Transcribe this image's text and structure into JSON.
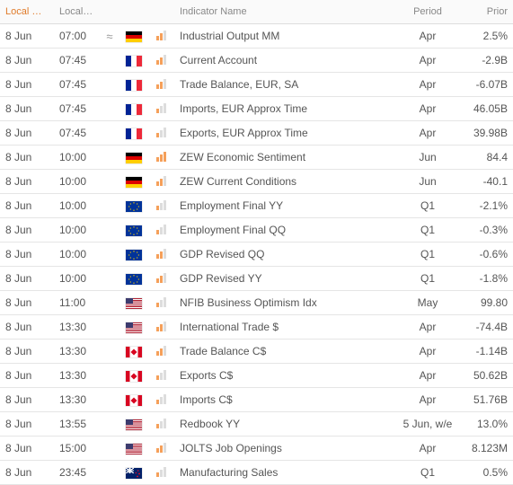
{
  "headers": {
    "date": "Local Date",
    "time": "Local Time",
    "name": "Indicator Name",
    "period": "Period",
    "prior": "Prior"
  },
  "rows": [
    {
      "date": "8 Jun",
      "time": "07:00",
      "approx": "≈",
      "flag": "de",
      "imp": 2,
      "name": "Industrial Output MM",
      "period": "Apr",
      "prior": "2.5%"
    },
    {
      "date": "8 Jun",
      "time": "07:45",
      "approx": "",
      "flag": "fr",
      "imp": 2,
      "name": "Current Account",
      "period": "Apr",
      "prior": "-2.9B"
    },
    {
      "date": "8 Jun",
      "time": "07:45",
      "approx": "",
      "flag": "fr",
      "imp": 2,
      "name": "Trade Balance, EUR, SA",
      "period": "Apr",
      "prior": "-6.07B"
    },
    {
      "date": "8 Jun",
      "time": "07:45",
      "approx": "",
      "flag": "fr",
      "imp": 1,
      "name": "Imports, EUR Approx Time",
      "period": "Apr",
      "prior": "46.05B"
    },
    {
      "date": "8 Jun",
      "time": "07:45",
      "approx": "",
      "flag": "fr",
      "imp": 1,
      "name": "Exports, EUR Approx Time",
      "period": "Apr",
      "prior": "39.98B"
    },
    {
      "date": "8 Jun",
      "time": "10:00",
      "approx": "",
      "flag": "de",
      "imp": 3,
      "name": "ZEW Economic Sentiment",
      "period": "Jun",
      "prior": "84.4"
    },
    {
      "date": "8 Jun",
      "time": "10:00",
      "approx": "",
      "flag": "de",
      "imp": 2,
      "name": "ZEW Current Conditions",
      "period": "Jun",
      "prior": "-40.1"
    },
    {
      "date": "8 Jun",
      "time": "10:00",
      "approx": "",
      "flag": "eu",
      "imp": 1,
      "name": "Employment Final YY",
      "period": "Q1",
      "prior": "-2.1%"
    },
    {
      "date": "8 Jun",
      "time": "10:00",
      "approx": "",
      "flag": "eu",
      "imp": 1,
      "name": "Employment Final QQ",
      "period": "Q1",
      "prior": "-0.3%"
    },
    {
      "date": "8 Jun",
      "time": "10:00",
      "approx": "",
      "flag": "eu",
      "imp": 2,
      "name": "GDP Revised QQ",
      "period": "Q1",
      "prior": "-0.6%"
    },
    {
      "date": "8 Jun",
      "time": "10:00",
      "approx": "",
      "flag": "eu",
      "imp": 2,
      "name": "GDP Revised YY",
      "period": "Q1",
      "prior": "-1.8%"
    },
    {
      "date": "8 Jun",
      "time": "11:00",
      "approx": "",
      "flag": "us",
      "imp": 1,
      "name": "NFIB Business Optimism Idx",
      "period": "May",
      "prior": "99.80"
    },
    {
      "date": "8 Jun",
      "time": "13:30",
      "approx": "",
      "flag": "us",
      "imp": 2,
      "name": "International Trade $",
      "period": "Apr",
      "prior": "-74.4B"
    },
    {
      "date": "8 Jun",
      "time": "13:30",
      "approx": "",
      "flag": "ca",
      "imp": 2,
      "name": "Trade Balance C$",
      "period": "Apr",
      "prior": "-1.14B"
    },
    {
      "date": "8 Jun",
      "time": "13:30",
      "approx": "",
      "flag": "ca",
      "imp": 1,
      "name": "Exports C$",
      "period": "Apr",
      "prior": "50.62B"
    },
    {
      "date": "8 Jun",
      "time": "13:30",
      "approx": "",
      "flag": "ca",
      "imp": 1,
      "name": "Imports C$",
      "period": "Apr",
      "prior": "51.76B"
    },
    {
      "date": "8 Jun",
      "time": "13:55",
      "approx": "",
      "flag": "us",
      "imp": 1,
      "name": "Redbook YY",
      "period": "5 Jun, w/e",
      "prior": "13.0%"
    },
    {
      "date": "8 Jun",
      "time": "15:00",
      "approx": "",
      "flag": "us",
      "imp": 2,
      "name": "JOLTS Job Openings",
      "period": "Apr",
      "prior": "8.123M"
    },
    {
      "date": "8 Jun",
      "time": "23:45",
      "approx": "",
      "flag": "nz",
      "imp": 1,
      "name": "Manufacturing Sales",
      "period": "Q1",
      "prior": "0.5%"
    }
  ]
}
